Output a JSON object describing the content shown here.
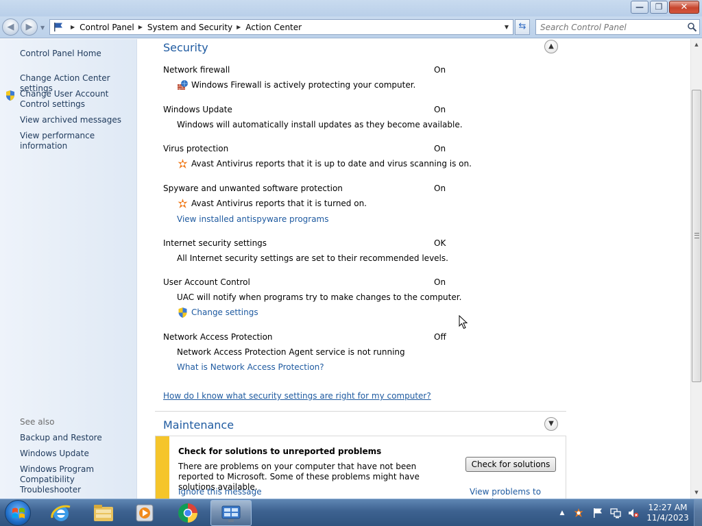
{
  "window": {
    "min_glyph": "—",
    "restore_glyph": "❐",
    "close_glyph": "✕"
  },
  "nav": {
    "back_glyph": "◀",
    "forward_glyph": "▶",
    "breadcrumb": [
      "Control Panel",
      "System and Security",
      "Action Center"
    ],
    "search_placeholder": "Search Control Panel",
    "refresh_glyph": "⇆"
  },
  "sidebar": {
    "home": "Control Panel Home",
    "links": [
      {
        "label": "Change Action Center settings"
      },
      {
        "label": "Change User Account Control settings"
      },
      {
        "label": "View archived messages"
      },
      {
        "label": "View performance information"
      }
    ],
    "see_also_title": "See also",
    "see_also": [
      {
        "label": "Backup and Restore"
      },
      {
        "label": "Windows Update"
      },
      {
        "label": "Windows Program Compatibility Troubleshooter"
      }
    ]
  },
  "security": {
    "title": "Security",
    "items": [
      {
        "name": "Network firewall",
        "status": "On",
        "desc": "Windows Firewall is actively protecting your computer.",
        "icon": "firewall-icon"
      },
      {
        "name": "Windows Update",
        "status": "On",
        "desc": "Windows will automatically install updates as they become available."
      },
      {
        "name": "Virus protection",
        "status": "On",
        "desc": "Avast Antivirus reports that it is up to date and virus scanning is on.",
        "icon": "avast-icon"
      },
      {
        "name": "Spyware and unwanted software protection",
        "status": "On",
        "desc": "Avast Antivirus reports that it is turned on.",
        "icon": "avast-icon",
        "link": "View installed antispyware programs"
      },
      {
        "name": "Internet security settings",
        "status": "OK",
        "desc": "All Internet security settings are set to their recommended levels."
      },
      {
        "name": "User Account Control",
        "status": "On",
        "desc": "UAC will notify when programs try to make changes to the computer.",
        "link": "Change settings",
        "link_icon": "uac-shield-icon"
      },
      {
        "name": "Network Access Protection",
        "status": "Off",
        "desc": "Network Access Protection Agent service is not running",
        "link": "What is Network Access Protection?"
      }
    ],
    "help_link": "How do I know what security settings are right for my computer?"
  },
  "maintenance": {
    "title": "Maintenance",
    "message_title": "Check for solutions to unreported problems",
    "message_body": "There are problems on your computer that have not been reported to Microsoft. Some of these problems might have solutions available.",
    "button": "Check for solutions",
    "ignore": "Ignore this message",
    "view": "View problems to report",
    "accent_color": "#f5c52b"
  },
  "taskbar": {
    "time": "12:27 AM",
    "date": "11/4/2023",
    "apps": [
      "internet-explorer-icon",
      "file-explorer-icon",
      "media-player-icon",
      "chrome-icon",
      "control-panel-icon"
    ]
  },
  "colors": {
    "link": "#1e5aa0",
    "nav_link": "#1e395b",
    "section_title": "#1e5aa0"
  }
}
